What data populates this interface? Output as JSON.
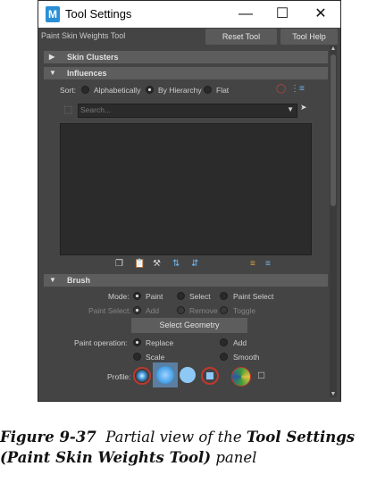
{
  "window": {
    "app_icon_letter": "M",
    "title": "Tool Settings",
    "minimize_glyph": "—",
    "maximize_glyph": "☐",
    "close_glyph": "✕"
  },
  "toolbar": {
    "tool_name": "Paint Skin Weights Tool",
    "reset_label": "Reset Tool",
    "help_label": "Tool Help"
  },
  "sections": {
    "skin_clusters": "Skin Clusters",
    "influences": "Influences",
    "brush": "Brush"
  },
  "influences": {
    "sort_label": "Sort:",
    "sort_options": [
      "Alphabetically",
      "By Hierarchy",
      "Flat"
    ],
    "sort_selected": "By Hierarchy",
    "search_placeholder": "Search..."
  },
  "brush": {
    "mode_label": "Mode:",
    "mode_options": [
      "Paint",
      "Select",
      "Paint Select"
    ],
    "mode_selected": "Paint",
    "paint_select_label": "Paint Select:",
    "paint_select_options": [
      "Add",
      "Remove",
      "Toggle"
    ],
    "select_geometry_label": "Select Geometry",
    "paint_operation_label": "Paint operation:",
    "paint_operation_options": [
      "Replace",
      "Add",
      "Scale",
      "Smooth"
    ],
    "paint_operation_selected": "Replace",
    "profile_label": "Profile:"
  },
  "caption": {
    "fig_num": "Figure 9-37",
    "text_1": "Partial view of the",
    "bold_1": "Tool Settings",
    "bold_2": "(Paint Skin Weights Tool)",
    "text_2": "panel"
  },
  "colors": {
    "panel_bg": "#444444",
    "section_bg": "#5d5d5d",
    "list_bg": "#2b2b2b",
    "accent_blue": "#4aa3e8",
    "red_ring": "#c0392b"
  }
}
